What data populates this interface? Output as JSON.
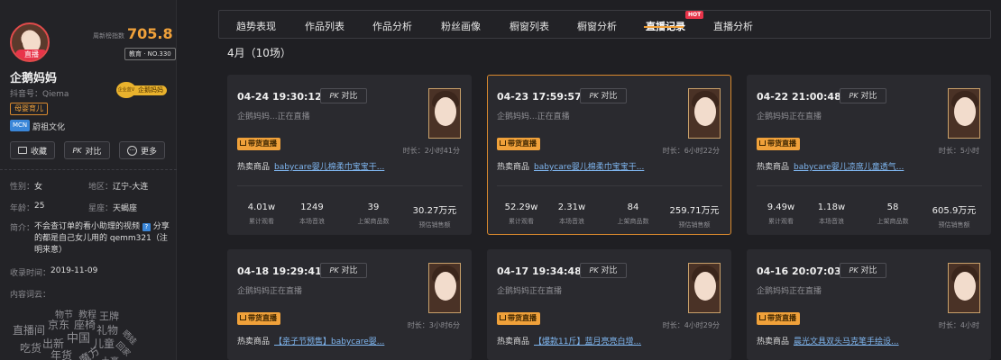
{
  "profile": {
    "avatar_tag": "直播",
    "index_label": "周新榜指数",
    "index_value": "705.8",
    "rank": "教育 · NO.330",
    "nickname": "企鹅妈妈",
    "douyin_id": "抖音号：Qiema",
    "blue_v_seal": "企业蓝V",
    "blue_v_name": "企鹅妈妈",
    "category": "母婴育儿",
    "mcn_label": "MCN",
    "mcn_name": "蔚祖文化",
    "buttons": {
      "favorite": "收藏",
      "pk": "对比",
      "more": "更多"
    },
    "info": {
      "gender_key": "性别：",
      "gender": "女",
      "area_key": "地区：",
      "area": "辽宁-大连",
      "age_key": "年龄：",
      "age": "25",
      "star_key": "星座：",
      "star": "天蝎座",
      "bio_key": "简介：",
      "bio_part1": "不会查订单的看小助理的视频",
      "bio_q": "?",
      "bio_part2": "分享的都是自己女儿用的 qemm321（注明来意）",
      "date_key": "收录时间：",
      "date": "2019-11-09",
      "words_key": "内容词云："
    },
    "word_cloud": [
      "物节",
      "教程",
      "王牌",
      "直播间",
      "京东",
      "座椅",
      "礼物",
      "出新",
      "中国",
      "儿童",
      "吃货",
      "年货",
      "魔方",
      "回家",
      "晒娃",
      "土豪"
    ]
  },
  "tabs": [
    "趋势表现",
    "作品列表",
    "作品分析",
    "粉丝画像",
    "橱窗列表",
    "橱窗分析",
    "直播记录",
    "直播分析"
  ],
  "active_tab": "直播记录",
  "hot_badge": "HOT",
  "month_title": "4月（10场）",
  "card_labels": {
    "pk_prefix": "PK",
    "pk": "对比",
    "goods_tag": "带货直播",
    "hot_label": "热卖商品",
    "stat_keys": [
      "累计观看",
      "本场音浪",
      "上架商品数",
      "预估销售额"
    ]
  },
  "sessions": [
    {
      "time": "04-24 19:30:12",
      "status": "企鹅妈妈...正在直播",
      "duration": "时长：2小时41分",
      "product": "babycare婴儿棉柔巾宝宝干...",
      "stats": [
        "4.01w",
        "1249",
        "39",
        "30.27万元"
      ]
    },
    {
      "time": "04-23 17:59:57",
      "status": "企鹅妈妈...正在直播",
      "duration": "时长：6小时22分",
      "product": "babycare婴儿棉柔巾宝宝干...",
      "stats": [
        "52.29w",
        "2.31w",
        "84",
        "259.71万元"
      ]
    },
    {
      "time": "04-22 21:00:48",
      "status": "企鹅妈妈正在直播",
      "duration": "时长：5小时",
      "product": "babycare婴儿凉席儿童透气...",
      "stats": [
        "9.49w",
        "1.18w",
        "58",
        "605.9万元"
      ]
    },
    {
      "time": "04-18 19:29:41",
      "status": "企鹅妈妈正在直播",
      "duration": "时长：3小时6分",
      "product": "【亲子节预售】babycare婴...",
      "stats": []
    },
    {
      "time": "04-17 19:34:48",
      "status": "企鹅妈妈正在直播",
      "duration": "时长：4小时29分",
      "product": "【爆款11斤】蓝月亮亮白增...",
      "stats": []
    },
    {
      "time": "04-16 20:07:03",
      "status": "企鹅妈妈正在直播",
      "duration": "时长：4小时",
      "product": "晨光文具双头马克笔手绘设...",
      "stats": []
    }
  ],
  "colors": {
    "accent": "#f0a13a",
    "link": "#7fb6f0",
    "live": "#e8344a"
  }
}
